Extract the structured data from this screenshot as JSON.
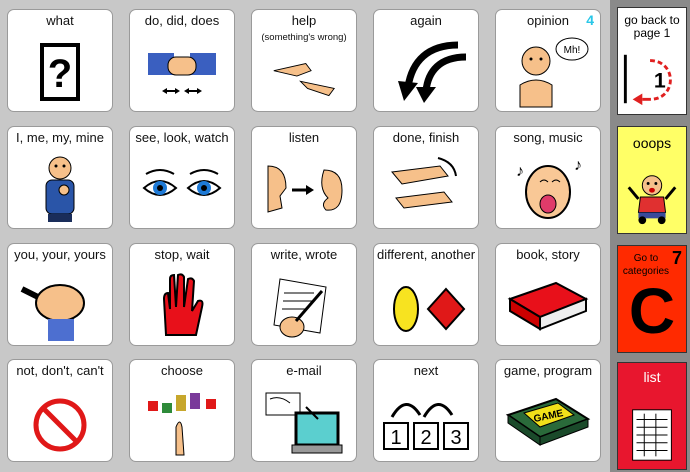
{
  "page_number": "4",
  "cells": [
    {
      "label": "what",
      "icon": "question-box-icon"
    },
    {
      "label": "do, did, does",
      "icon": "hands-doing-icon"
    },
    {
      "label": "help",
      "sublabel": "(something's wrong)",
      "icon": "helping-hands-icon"
    },
    {
      "label": "again",
      "icon": "curved-arrows-icon"
    },
    {
      "label": "opinion",
      "icon": "person-speaking-icon"
    },
    {
      "label": "I, me, my, mine",
      "icon": "person-pointing-self-icon"
    },
    {
      "label": "see, look, watch",
      "icon": "eyes-icon"
    },
    {
      "label": "listen",
      "icon": "ear-listening-icon"
    },
    {
      "label": "done, finish",
      "icon": "hands-finish-icon"
    },
    {
      "label": "song, music",
      "icon": "singing-face-icon"
    },
    {
      "label": "you, your, yours",
      "icon": "pointing-fist-icon"
    },
    {
      "label": "stop, wait",
      "icon": "red-hand-icon"
    },
    {
      "label": "write, wrote",
      "icon": "writing-hand-icon"
    },
    {
      "label": "different, another",
      "icon": "oval-diamond-icon"
    },
    {
      "label": "book, story",
      "icon": "red-book-icon"
    },
    {
      "label": "not, don't, can't",
      "icon": "no-sign-icon"
    },
    {
      "label": "choose",
      "icon": "choose-squares-icon"
    },
    {
      "label": "e-mail",
      "icon": "computer-mail-icon"
    },
    {
      "label": "next",
      "icon": "next-123-icon"
    },
    {
      "label": "game, program",
      "icon": "game-box-icon"
    }
  ],
  "sidebar": {
    "back": {
      "label": "go back to page 1",
      "number": "1",
      "bg": "#ffffff"
    },
    "ooops": {
      "label": "ooops",
      "bg": "#ffff66"
    },
    "categories": {
      "label": "Go to categories",
      "letter": "C",
      "number": "7",
      "bg": "#ff2a00"
    },
    "list": {
      "label": "list",
      "bg": "#e8162e"
    }
  }
}
